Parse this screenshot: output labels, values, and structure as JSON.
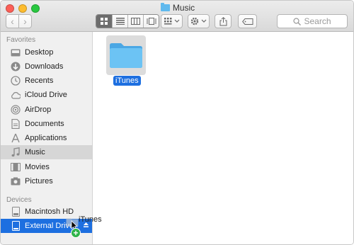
{
  "window": {
    "title": "Music",
    "traffic_lights": {
      "close": "#fc5f57",
      "minimize": "#fdbc2e",
      "zoom": "#28c840"
    }
  },
  "toolbar": {
    "back_icon": "chevron-left-icon",
    "forward_icon": "chevron-right-icon",
    "view_modes": [
      "icon-view",
      "list-view",
      "column-view",
      "gallery-view"
    ],
    "search_placeholder": "Search"
  },
  "sidebar": {
    "favorites_title": "Favorites",
    "favorites": [
      {
        "label": "Desktop",
        "icon": "desktop-icon"
      },
      {
        "label": "Downloads",
        "icon": "downloads-icon"
      },
      {
        "label": "Recents",
        "icon": "recents-icon"
      },
      {
        "label": "iCloud Drive",
        "icon": "cloud-icon"
      },
      {
        "label": "AirDrop",
        "icon": "airdrop-icon"
      },
      {
        "label": "Documents",
        "icon": "documents-icon"
      },
      {
        "label": "Applications",
        "icon": "applications-icon"
      },
      {
        "label": "Music",
        "icon": "music-icon",
        "selected": true
      },
      {
        "label": "Movies",
        "icon": "movies-icon"
      },
      {
        "label": "Pictures",
        "icon": "pictures-icon"
      }
    ],
    "devices_title": "Devices",
    "devices": [
      {
        "label": "Macintosh HD",
        "icon": "hard-drive-icon"
      },
      {
        "label": "External Drive",
        "icon": "external-drive-icon",
        "drop_target": true
      }
    ]
  },
  "content": {
    "items": [
      {
        "label": "iTunes",
        "icon": "folder-icon",
        "selected": true
      }
    ]
  },
  "drag": {
    "label": "iTunes",
    "badge": "+"
  },
  "colors": {
    "accent": "#1d6fe0",
    "folder": "#5fb9ee",
    "copy_badge": "#2fb44a"
  }
}
